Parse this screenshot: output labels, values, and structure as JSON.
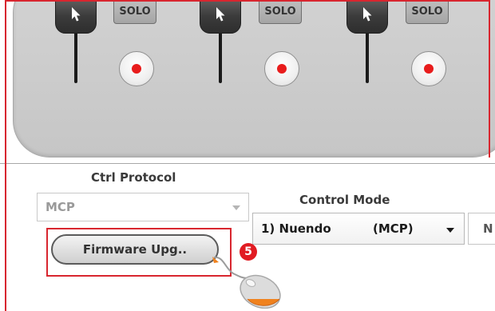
{
  "strips": [
    {
      "solo_label": "SOLO"
    },
    {
      "solo_label": "SOLO"
    },
    {
      "solo_label": "SOLO"
    }
  ],
  "ctrl_protocol": {
    "label": "Ctrl Protocol",
    "value": "MCP"
  },
  "control_mode": {
    "label": "Control Mode",
    "value_name": "1) Nuendo",
    "value_proto": "(MCP)",
    "next_value": "N"
  },
  "firmware_button_label": "Firmware Upg..",
  "step_badge": "5",
  "colors": {
    "highlight": "#d8262f",
    "badge": "#e11b22",
    "record": "#e81c1c",
    "mouse_wheel": "#f0821e"
  },
  "icons": [
    "cursor-arrow-icon",
    "record-dot-icon",
    "dropdown-arrow-icon",
    "mouse-icon"
  ]
}
